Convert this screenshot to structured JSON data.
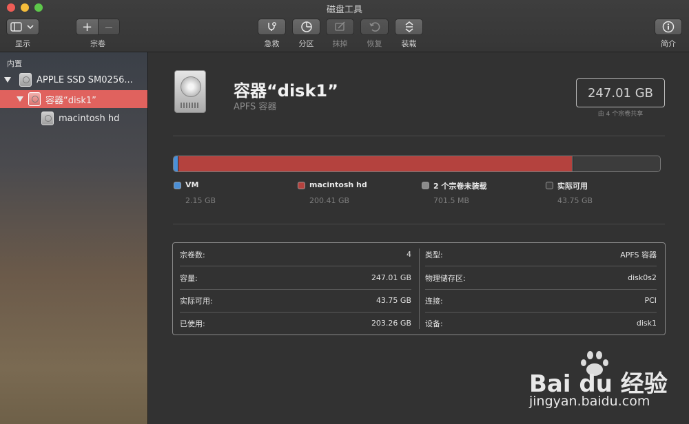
{
  "window": {
    "title": "磁盘工具"
  },
  "toolbar": {
    "view_label": "显示",
    "volume_label": "宗卷",
    "first_aid_label": "急救",
    "partition_label": "分区",
    "erase_label": "抹掉",
    "restore_label": "恢复",
    "mount_label": "装载",
    "info_label": "简介",
    "add_glyph": "+",
    "remove_glyph": "−"
  },
  "sidebar": {
    "section": "内置",
    "items": [
      {
        "label": "APPLE SSD SM0256...",
        "level": 0,
        "selected": false,
        "expanded": true
      },
      {
        "label": "容器“disk1”",
        "level": 1,
        "selected": true,
        "expanded": true
      },
      {
        "label": "macintosh hd",
        "level": 2,
        "selected": false
      }
    ]
  },
  "header": {
    "title": "容器“disk1”",
    "subtitle": "APFS 容器",
    "capacity": "247.01 GB",
    "capacity_note": "由 4 个宗卷共享"
  },
  "usage": {
    "segments": [
      {
        "name": "VM",
        "size": "2.15 GB",
        "gb": 2.15,
        "color": "#4b8fd6"
      },
      {
        "name": "macintosh hd",
        "size": "200.41 GB",
        "gb": 200.41,
        "color": "#b4423e"
      },
      {
        "name": "2 个宗卷未装载",
        "size": "701.5 MB",
        "gb": 0.7015,
        "color": "#8b8b8b"
      },
      {
        "name": "实际可用",
        "size": "43.75 GB",
        "gb": 43.75,
        "color": "#3c3c3c"
      }
    ]
  },
  "info": {
    "left": [
      {
        "label": "宗卷数:",
        "value": "4"
      },
      {
        "label": "容量:",
        "value": "247.01 GB"
      },
      {
        "label": "实际可用:",
        "value": "43.75 GB"
      },
      {
        "label": "已使用:",
        "value": "203.26 GB"
      }
    ],
    "right": [
      {
        "label": "类型:",
        "value": "APFS 容器"
      },
      {
        "label": "物理储存区:",
        "value": "disk0s2"
      },
      {
        "label": "连接:",
        "value": "PCI"
      },
      {
        "label": "设备:",
        "value": "disk1"
      }
    ]
  },
  "watermark": {
    "brand": "Bai du 经验",
    "url": "jingyan.baidu.com"
  }
}
